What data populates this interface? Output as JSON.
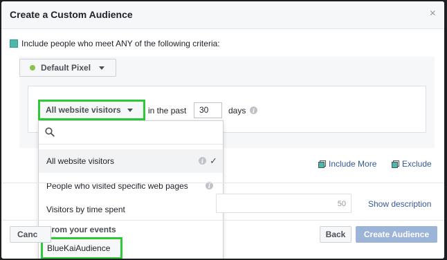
{
  "dialog": {
    "title": "Create a Custom Audience",
    "close_icon": "close-icon",
    "close_glyph": "×"
  },
  "criteria": {
    "include_text": "Include people who meet ANY of the following criteria:",
    "pixel_label": "Default Pixel",
    "visitors_label": "All website visitors",
    "in_the_past": "in the past",
    "days_value": "30",
    "days_label": "days"
  },
  "dropdown": {
    "search_placeholder": "",
    "options": [
      {
        "label": "All website visitors",
        "selected": true
      },
      {
        "label": "People who visited specific web pages"
      },
      {
        "label": "Visitors by time spent"
      }
    ],
    "section_header": "From your events",
    "event_item": "BlueKaiAudience"
  },
  "actions": {
    "include_more": "Include More",
    "exclude": "Exclude"
  },
  "description": {
    "counter": "50",
    "show_description": "Show description"
  },
  "footer": {
    "cancel": "Canc",
    "back": "Back",
    "create": "Create Audience"
  },
  "colors": {
    "highlight_green": "#2dc937",
    "teal": "#4bb8a9",
    "link_blue": "#365899",
    "create_disabled": "#9cb4d8",
    "pixel_dot": "#8bc34a"
  }
}
